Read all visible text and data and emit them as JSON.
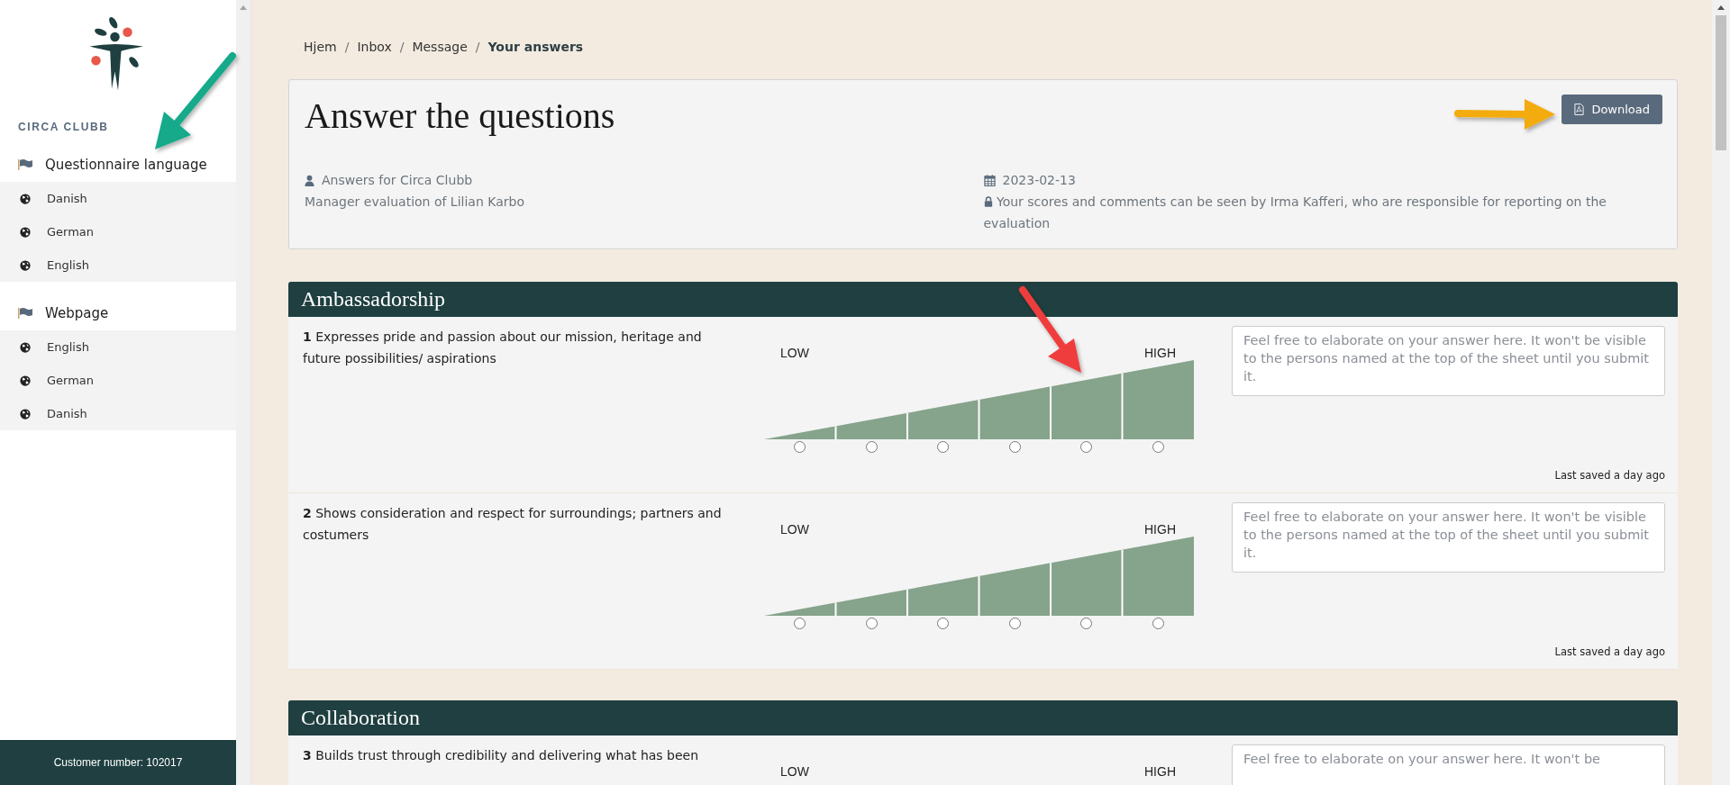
{
  "sidebar": {
    "brand": "CIRCA CLUBB",
    "groups": [
      {
        "title": "Questionnaire language",
        "items": [
          {
            "label": "Danish"
          },
          {
            "label": "German"
          },
          {
            "label": "English"
          }
        ]
      },
      {
        "title": "Webpage",
        "items": [
          {
            "label": "English"
          },
          {
            "label": "German"
          },
          {
            "label": "Danish"
          }
        ]
      }
    ],
    "footer": "Customer number: 102017"
  },
  "breadcrumb": [
    {
      "label": "Hjem",
      "current": false,
      "separator": "/"
    },
    {
      "label": "Inbox",
      "current": false,
      "separator": "/"
    },
    {
      "label": "Message",
      "current": false,
      "separator": "/"
    },
    {
      "label": "Your answers",
      "current": true
    }
  ],
  "header": {
    "title": "Answer the questions",
    "download_button": "Download",
    "answers_for": "Answers for Circa Clubb",
    "evaluation": "Manager evaluation of Lilian Karbo",
    "date": "2023-02-13",
    "visibility_note": "Your scores and comments can be seen by Irma Kafferi, who are responsible for reporting on the evaluation"
  },
  "sections": [
    {
      "title": "Ambassadorship",
      "questions": [
        {
          "number": "1",
          "text": "Expresses pride and passion about our mission, heritage and future possibilities/ aspirations",
          "low_label": "LOW",
          "high_label": "HIGH",
          "options": [
            {
              "selected": false
            },
            {
              "selected": false
            },
            {
              "selected": false
            },
            {
              "selected": false
            },
            {
              "selected": false
            },
            {
              "selected": false
            }
          ],
          "placeholder": "Feel free to elaborate on your answer here. It won't be visible to the persons named at the top of the sheet until you submit it.",
          "saved": "Last saved a day ago"
        },
        {
          "number": "2",
          "text": "Shows consideration and respect for surroundings; partners and costumers",
          "low_label": "LOW",
          "high_label": "HIGH",
          "options": [
            {
              "selected": false
            },
            {
              "selected": false
            },
            {
              "selected": false
            },
            {
              "selected": false
            },
            {
              "selected": false
            },
            {
              "selected": false
            }
          ],
          "placeholder": "Feel free to elaborate on your answer here. It won't be visible to the persons named at the top of the sheet until you submit it.",
          "saved": "Last saved a day ago"
        }
      ]
    },
    {
      "title": "Collaboration",
      "questions": [
        {
          "number": "3",
          "text": "Builds trust through credibility and delivering what has been",
          "low_label": "LOW",
          "high_label": "HIGH",
          "placeholder": "Feel free to elaborate on your answer here. It won't be"
        }
      ]
    }
  ]
}
